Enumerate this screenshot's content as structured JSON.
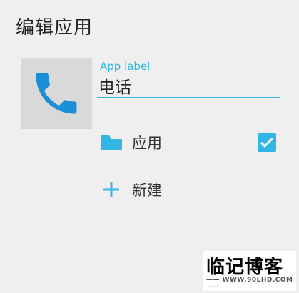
{
  "dialog": {
    "title": "编辑应用"
  },
  "app": {
    "icon": "phone-icon",
    "label_caption": "App label",
    "label_value": "电话"
  },
  "rows": {
    "apps": {
      "icon": "folder-icon",
      "label": "应用",
      "checked": true
    },
    "new": {
      "icon": "plus-icon",
      "label": "新建"
    }
  },
  "watermark": {
    "title": "临记博客",
    "url": "—— WWW.90LHD.COM ——"
  },
  "colors": {
    "accent": "#33b5e5",
    "background": "#efefef",
    "phone_icon": "#1a8fd6"
  }
}
